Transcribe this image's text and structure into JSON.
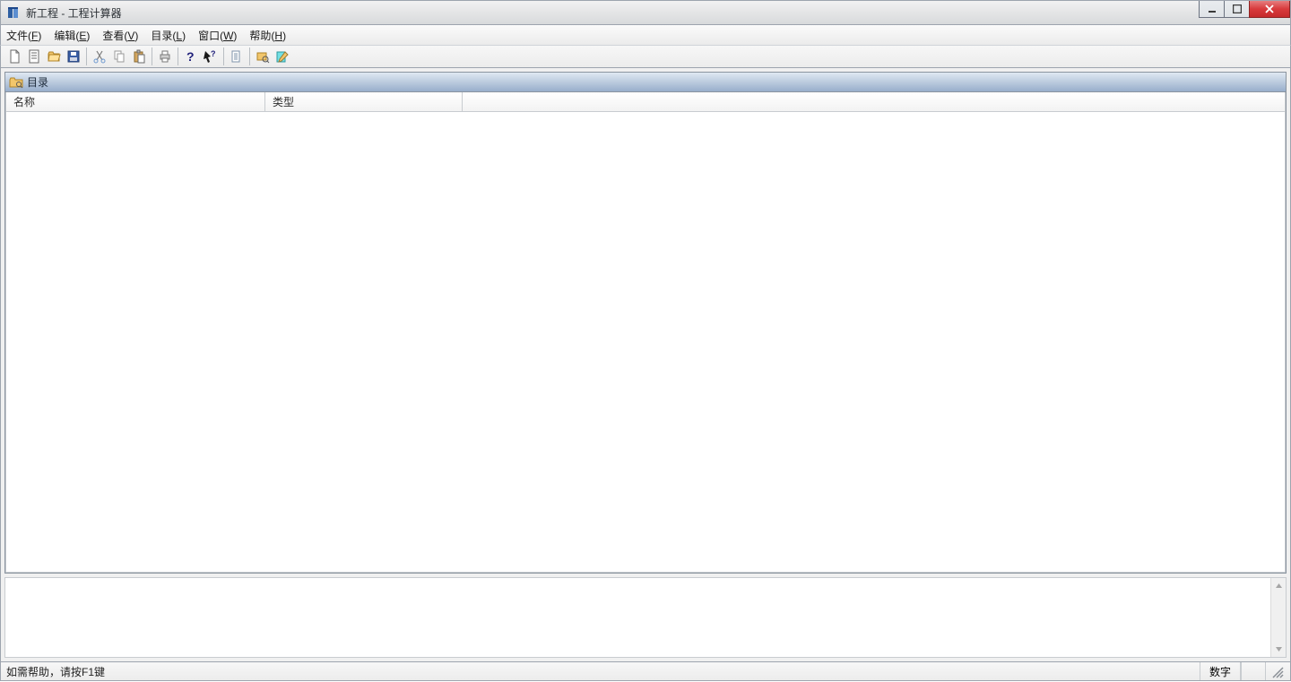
{
  "window": {
    "title": "新工程 - 工程计算器"
  },
  "menu": {
    "file": {
      "pre": "文件(",
      "u": "F",
      "post": ")"
    },
    "edit": {
      "pre": "编辑(",
      "u": "E",
      "post": ")"
    },
    "view": {
      "pre": "查看(",
      "u": "V",
      "post": ")"
    },
    "catalog": {
      "pre": "目录(",
      "u": "L",
      "post": ")"
    },
    "window": {
      "pre": "窗口(",
      "u": "W",
      "post": ")"
    },
    "help": {
      "pre": "帮助(",
      "u": "H",
      "post": ")"
    }
  },
  "panel": {
    "title": "目录"
  },
  "columns": {
    "name": "名称",
    "type": "类型"
  },
  "status": {
    "help": "如需帮助，请按F1键",
    "num": "数字"
  }
}
